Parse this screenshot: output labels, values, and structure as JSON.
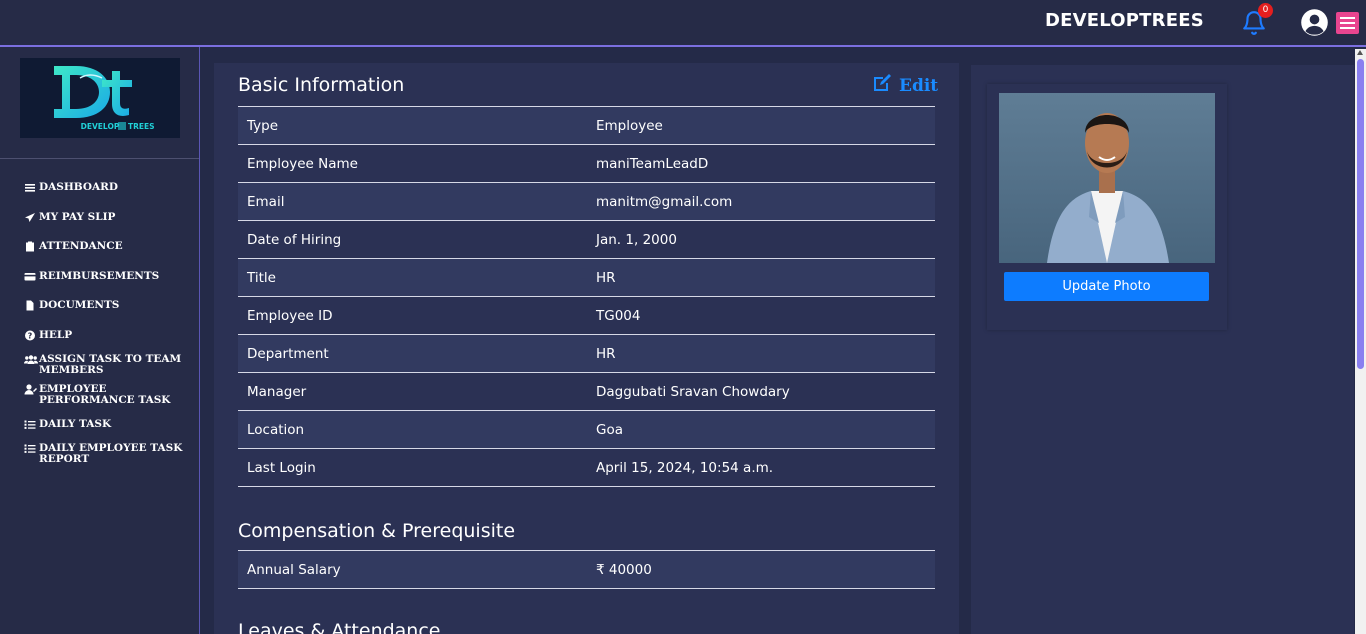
{
  "header": {
    "brand": "DEVELOPTREES",
    "notification_count": "0"
  },
  "sidebar": {
    "items": [
      {
        "label": "DASHBOARD",
        "icon": "list-icon"
      },
      {
        "label": "MY PAY SLIP",
        "icon": "paper-plane-icon"
      },
      {
        "label": "ATTENDANCE",
        "icon": "clipboard-icon"
      },
      {
        "label": "REIMBURSEMENTS",
        "icon": "credit-card-icon"
      },
      {
        "label": "DOCUMENTS",
        "icon": "file-icon"
      },
      {
        "label": "HELP",
        "icon": "question-circle-icon"
      },
      {
        "label": "ASSIGN TASK TO TEAM MEMBERS",
        "icon": "users-icon"
      },
      {
        "label": "EMPLOYEE PERFORMANCE TASK",
        "icon": "user-edit-icon"
      },
      {
        "label": "DAILY TASK",
        "icon": "tasks-icon"
      },
      {
        "label": "DAILY EMPLOYEE TASK REPORT",
        "icon": "tasks-icon"
      }
    ]
  },
  "basic_info": {
    "title": "Basic Information",
    "edit_label": "Edit",
    "rows": [
      {
        "label": "Type",
        "value": "Employee"
      },
      {
        "label": "Employee Name",
        "value": "maniTeamLeadD"
      },
      {
        "label": "Email",
        "value": "manitm@gmail.com"
      },
      {
        "label": "Date of Hiring",
        "value": "Jan. 1, 2000"
      },
      {
        "label": "Title",
        "value": "HR"
      },
      {
        "label": "Employee ID",
        "value": "TG004"
      },
      {
        "label": "Department",
        "value": "HR"
      },
      {
        "label": "Manager",
        "value": "Daggubati Sravan Chowdary"
      },
      {
        "label": "Location",
        "value": "Goa"
      },
      {
        "label": "Last Login",
        "value": "April 15, 2024, 10:54 a.m."
      }
    ]
  },
  "compensation": {
    "title": "Compensation & Prerequisite",
    "rows": [
      {
        "label": "Annual Salary",
        "value": "₹  40000"
      }
    ]
  },
  "leaves": {
    "title": "Leaves & Attendance"
  },
  "profile": {
    "update_photo_label": "Update Photo"
  },
  "colors": {
    "accent": "#0d7cff",
    "edit": "#1a8bff",
    "menu_button": "#e8458f",
    "badge": "#e41e1e",
    "background": "#242a48",
    "card": "#2b3154"
  }
}
